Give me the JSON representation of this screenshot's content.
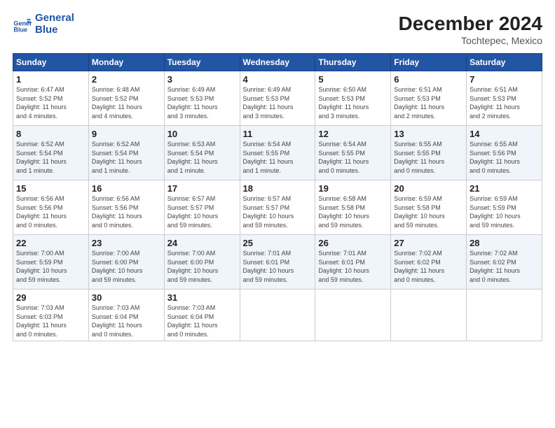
{
  "header": {
    "logo_line1": "General",
    "logo_line2": "Blue",
    "month": "December 2024",
    "location": "Tochtepec, Mexico"
  },
  "weekdays": [
    "Sunday",
    "Monday",
    "Tuesday",
    "Wednesday",
    "Thursday",
    "Friday",
    "Saturday"
  ],
  "weeks": [
    [
      {
        "day": "1",
        "info": "Sunrise: 6:47 AM\nSunset: 5:52 PM\nDaylight: 11 hours\nand 4 minutes."
      },
      {
        "day": "2",
        "info": "Sunrise: 6:48 AM\nSunset: 5:52 PM\nDaylight: 11 hours\nand 4 minutes."
      },
      {
        "day": "3",
        "info": "Sunrise: 6:49 AM\nSunset: 5:53 PM\nDaylight: 11 hours\nand 3 minutes."
      },
      {
        "day": "4",
        "info": "Sunrise: 6:49 AM\nSunset: 5:53 PM\nDaylight: 11 hours\nand 3 minutes."
      },
      {
        "day": "5",
        "info": "Sunrise: 6:50 AM\nSunset: 5:53 PM\nDaylight: 11 hours\nand 3 minutes."
      },
      {
        "day": "6",
        "info": "Sunrise: 6:51 AM\nSunset: 5:53 PM\nDaylight: 11 hours\nand 2 minutes."
      },
      {
        "day": "7",
        "info": "Sunrise: 6:51 AM\nSunset: 5:53 PM\nDaylight: 11 hours\nand 2 minutes."
      }
    ],
    [
      {
        "day": "8",
        "info": "Sunrise: 6:52 AM\nSunset: 5:54 PM\nDaylight: 11 hours\nand 1 minute."
      },
      {
        "day": "9",
        "info": "Sunrise: 6:52 AM\nSunset: 5:54 PM\nDaylight: 11 hours\nand 1 minute."
      },
      {
        "day": "10",
        "info": "Sunrise: 6:53 AM\nSunset: 5:54 PM\nDaylight: 11 hours\nand 1 minute."
      },
      {
        "day": "11",
        "info": "Sunrise: 6:54 AM\nSunset: 5:55 PM\nDaylight: 11 hours\nand 1 minute."
      },
      {
        "day": "12",
        "info": "Sunrise: 6:54 AM\nSunset: 5:55 PM\nDaylight: 11 hours\nand 0 minutes."
      },
      {
        "day": "13",
        "info": "Sunrise: 6:55 AM\nSunset: 5:55 PM\nDaylight: 11 hours\nand 0 minutes."
      },
      {
        "day": "14",
        "info": "Sunrise: 6:55 AM\nSunset: 5:56 PM\nDaylight: 11 hours\nand 0 minutes."
      }
    ],
    [
      {
        "day": "15",
        "info": "Sunrise: 6:56 AM\nSunset: 5:56 PM\nDaylight: 11 hours\nand 0 minutes."
      },
      {
        "day": "16",
        "info": "Sunrise: 6:56 AM\nSunset: 5:56 PM\nDaylight: 11 hours\nand 0 minutes."
      },
      {
        "day": "17",
        "info": "Sunrise: 6:57 AM\nSunset: 5:57 PM\nDaylight: 10 hours\nand 59 minutes."
      },
      {
        "day": "18",
        "info": "Sunrise: 6:57 AM\nSunset: 5:57 PM\nDaylight: 10 hours\nand 59 minutes."
      },
      {
        "day": "19",
        "info": "Sunrise: 6:58 AM\nSunset: 5:58 PM\nDaylight: 10 hours\nand 59 minutes."
      },
      {
        "day": "20",
        "info": "Sunrise: 6:59 AM\nSunset: 5:58 PM\nDaylight: 10 hours\nand 59 minutes."
      },
      {
        "day": "21",
        "info": "Sunrise: 6:59 AM\nSunset: 5:59 PM\nDaylight: 10 hours\nand 59 minutes."
      }
    ],
    [
      {
        "day": "22",
        "info": "Sunrise: 7:00 AM\nSunset: 5:59 PM\nDaylight: 10 hours\nand 59 minutes."
      },
      {
        "day": "23",
        "info": "Sunrise: 7:00 AM\nSunset: 6:00 PM\nDaylight: 10 hours\nand 59 minutes."
      },
      {
        "day": "24",
        "info": "Sunrise: 7:00 AM\nSunset: 6:00 PM\nDaylight: 10 hours\nand 59 minutes."
      },
      {
        "day": "25",
        "info": "Sunrise: 7:01 AM\nSunset: 6:01 PM\nDaylight: 10 hours\nand 59 minutes."
      },
      {
        "day": "26",
        "info": "Sunrise: 7:01 AM\nSunset: 6:01 PM\nDaylight: 10 hours\nand 59 minutes."
      },
      {
        "day": "27",
        "info": "Sunrise: 7:02 AM\nSunset: 6:02 PM\nDaylight: 11 hours\nand 0 minutes."
      },
      {
        "day": "28",
        "info": "Sunrise: 7:02 AM\nSunset: 6:02 PM\nDaylight: 11 hours\nand 0 minutes."
      }
    ],
    [
      {
        "day": "29",
        "info": "Sunrise: 7:03 AM\nSunset: 6:03 PM\nDaylight: 11 hours\nand 0 minutes."
      },
      {
        "day": "30",
        "info": "Sunrise: 7:03 AM\nSunset: 6:04 PM\nDaylight: 11 hours\nand 0 minutes."
      },
      {
        "day": "31",
        "info": "Sunrise: 7:03 AM\nSunset: 6:04 PM\nDaylight: 11 hours\nand 0 minutes."
      },
      {
        "day": "",
        "info": ""
      },
      {
        "day": "",
        "info": ""
      },
      {
        "day": "",
        "info": ""
      },
      {
        "day": "",
        "info": ""
      }
    ]
  ]
}
